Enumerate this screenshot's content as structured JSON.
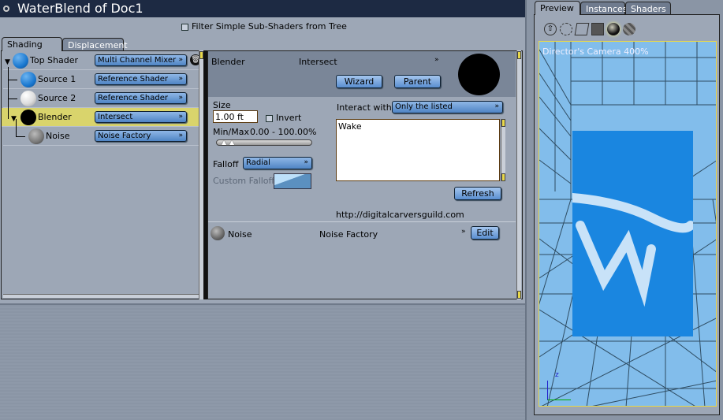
{
  "window": {
    "title": "WaterBlend of Doc1"
  },
  "filter": {
    "label": "Filter Simple Sub-Shaders from Tree",
    "checked": false
  },
  "tabs": [
    {
      "label": "Shading",
      "active": true
    },
    {
      "label": "Displacement",
      "active": false
    }
  ],
  "tree": [
    {
      "name": "Top Shader",
      "type": "Multi Channel Mixer",
      "ball": "#1a78d0"
    },
    {
      "name": "Source 1",
      "type": "Reference Shader",
      "ball": "#1a78d0"
    },
    {
      "name": "Source 2",
      "type": "Reference Shader",
      "ball": "#e6e6e6"
    },
    {
      "name": "Blender",
      "type": "Intersect",
      "ball": "#000000",
      "selected": true
    },
    {
      "name": "Noise",
      "type": "Noise Factory",
      "ball": "#888888"
    }
  ],
  "detail": {
    "name": "Blender",
    "type": "Intersect",
    "wizard": "Wizard",
    "parent": "Parent",
    "size_label": "Size",
    "size_value": "1.00 ft",
    "invert_label": "Invert",
    "minmax_label": "Min/Max",
    "minmax_value": "0.00 - 100.00%",
    "falloff_label": "Falloff",
    "falloff_value": "Radial",
    "custom_falloff_label": "Custom Falloff",
    "interact_label": "Interact with",
    "interact_value": "Only the listed",
    "list_items": [
      "Wake"
    ],
    "refresh": "Refresh",
    "url": "http://digitalcarversguild.com",
    "child_name": "Noise",
    "child_type": "Noise Factory",
    "edit": "Edit"
  },
  "preview": {
    "tabs": [
      {
        "label": "Preview",
        "active": true
      },
      {
        "label": "Instances"
      },
      {
        "label": "Shaders"
      }
    ],
    "camera_label": "Director's Camera 400%",
    "icons": [
      "move-icon",
      "bounding-box-icon",
      "wireframe-icon",
      "flat-shaded-icon",
      "smooth-shaded-icon",
      "textured-icon"
    ]
  },
  "colors": {
    "titlebar": "#1d2a43",
    "selection": "#d9d46c",
    "water": "#1a86e0",
    "grid": "#82bdeb"
  }
}
